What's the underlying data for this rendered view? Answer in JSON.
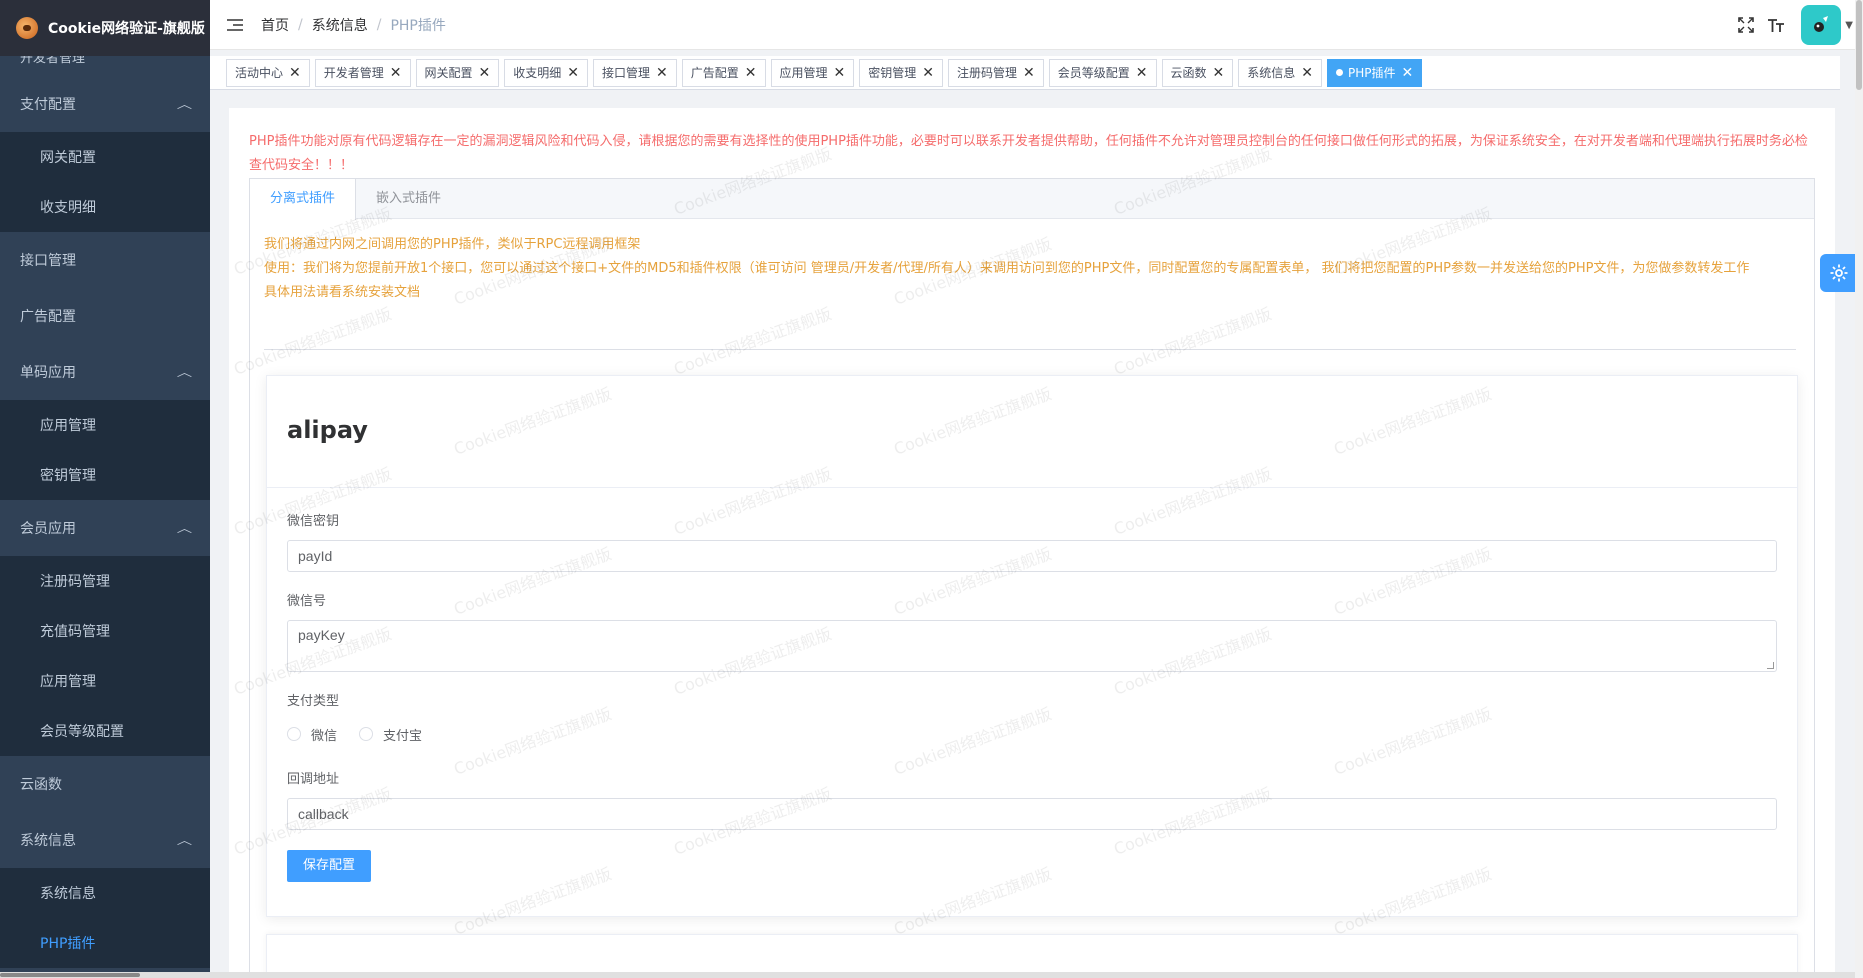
{
  "app": {
    "title": "Cookie网络验证-旗舰版"
  },
  "sidebar": {
    "cut_item": "开发者管理",
    "groups": [
      {
        "label": "支付配置",
        "arrow": "︿",
        "items": [
          "网关配置",
          "收支明细"
        ]
      },
      {
        "label": "接口管理"
      },
      {
        "label": "广告配置"
      },
      {
        "label": "单码应用",
        "arrow": "︿",
        "items": [
          "应用管理",
          "密钥管理"
        ]
      },
      {
        "label": "会员应用",
        "arrow": "︿",
        "items": [
          "注册码管理",
          "充值码管理",
          "应用管理",
          "会员等级配置"
        ]
      },
      {
        "label": "云函数"
      },
      {
        "label": "系统信息",
        "arrow": "︿",
        "items": [
          "系统信息",
          "PHP插件"
        ]
      }
    ]
  },
  "breadcrumb": [
    "首页",
    "系统信息",
    "PHP插件"
  ],
  "tags": [
    "活动中心",
    "开发者管理",
    "网关配置",
    "收支明细",
    "接口管理",
    "广告配置",
    "应用管理",
    "密钥管理",
    "注册码管理",
    "会员等级配置",
    "云函数",
    "系统信息",
    "PHP插件"
  ],
  "tags_close_glyph": "✕",
  "warning": "PHP插件功能对原有代码逻辑存在一定的漏洞逻辑风险和代码入侵，请根据您的需要有选择性的使用PHP插件功能，必要时可以联系开发者提供帮助，任何插件不允许对管理员控制台的任何接口做任何形式的拓展，为保证系统安全，在对开发者端和代理端执行拓展时务必检查代码安全！！！",
  "tabs": [
    "分离式插件",
    "嵌入式插件"
  ],
  "info": {
    "line1": "我们将通过内网之间调用您的PHP插件，类似于RPC远程调用框架",
    "line2": "使用：我们将为您提前开放1个接口，您可以通过这个接口+文件的MD5和插件权限（谁可访问 管理员/开发者/代理/所有人）来调用访问到您的PHP文件，同时配置您的专属配置表单， 我们将把您配置的PHP参数一并发送给您的PHP文件，为您做参数转发工作",
    "line3": "具体用法请看系统安装文档"
  },
  "plugin": {
    "name": "alipay",
    "fields": {
      "secret_label": "微信密钥",
      "secret_value": "payId",
      "account_label": "微信号",
      "account_value": "payKey",
      "pay_type_label": "支付类型",
      "pay_options": [
        "微信",
        "支付宝"
      ],
      "callback_label": "回调地址",
      "callback_value": "callback"
    },
    "save_label": "保存配置"
  },
  "watermark": "Cookie网络验证旗舰版",
  "icons": {
    "menu_toggle": "hamburger-icon",
    "fullscreen": "fullscreen-icon",
    "font_size": "font-size-icon",
    "settings": "gear-icon"
  },
  "colors": {
    "sidebar": "#304156",
    "submenu": "#1f2d3d",
    "accent": "#409eff",
    "warning": "#f56c6c",
    "info": "#e6a23c"
  }
}
